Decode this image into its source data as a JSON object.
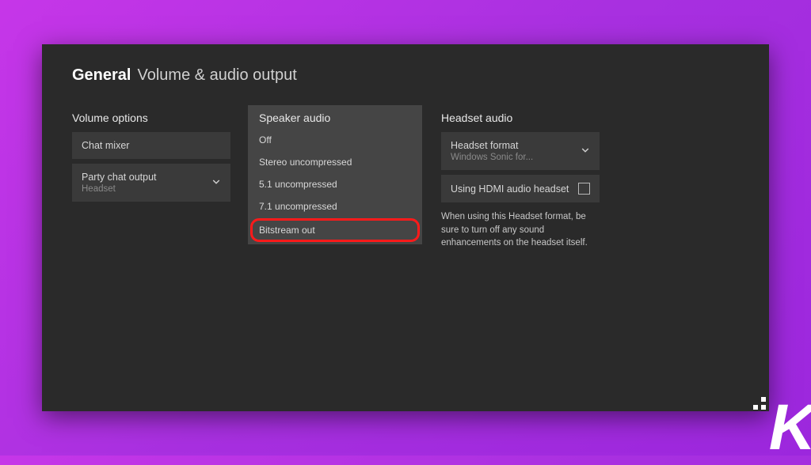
{
  "header": {
    "category": "General",
    "subtitle": "Volume & audio output"
  },
  "volume": {
    "title": "Volume options",
    "chat_mixer_label": "Chat mixer",
    "party_chat_label": "Party chat output",
    "party_chat_value": "Headset"
  },
  "speaker": {
    "title": "Speaker audio",
    "options": {
      "0": "Off",
      "1": "Stereo uncompressed",
      "2": "5.1 uncompressed",
      "3": "7.1 uncompressed",
      "4": "Bitstream out"
    }
  },
  "headset": {
    "title": "Headset audio",
    "format_label": "Headset format",
    "format_value": "Windows Sonic for...",
    "hdmi_label": "Using HDMI audio headset",
    "note": "When using this Headset format, be sure to turn off any sound enhancements on the headset itself."
  }
}
